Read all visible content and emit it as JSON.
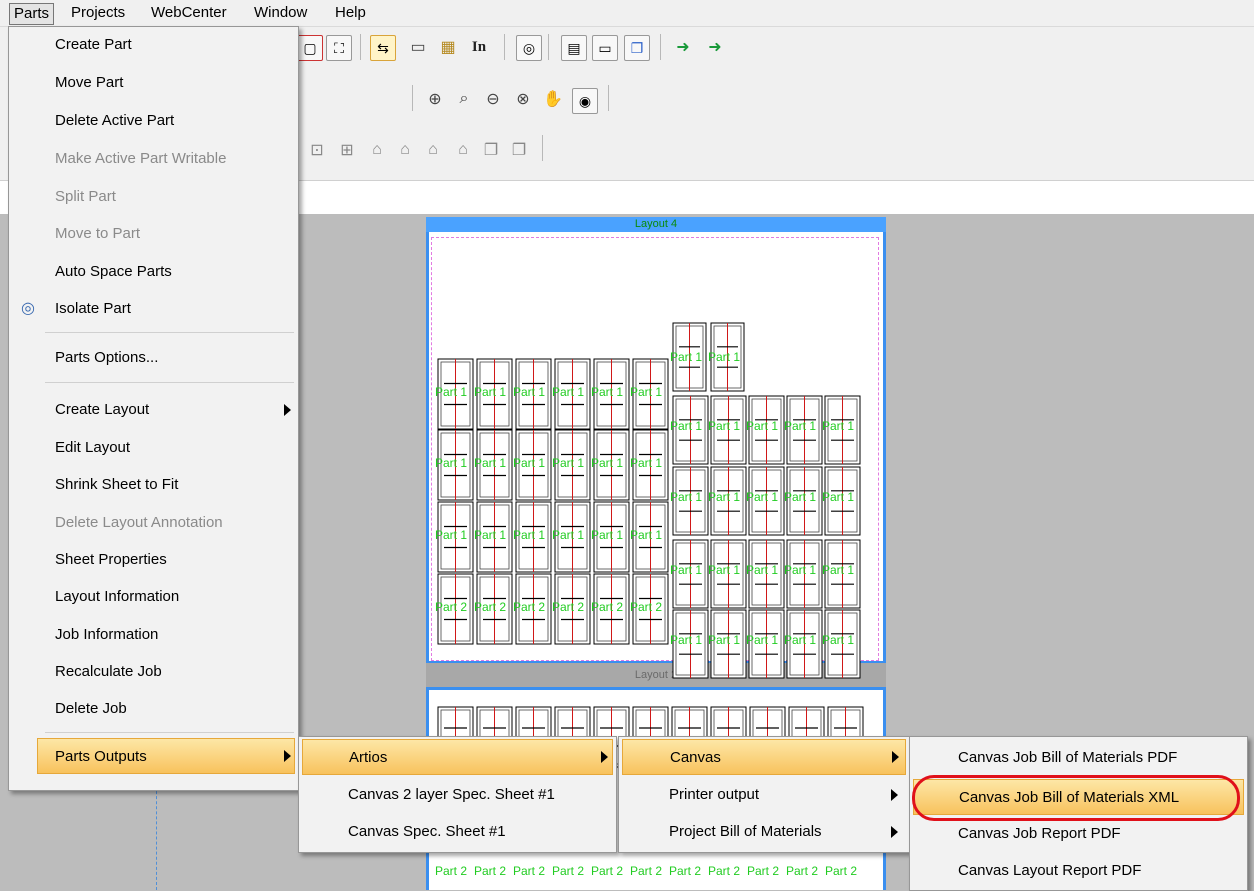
{
  "menubar": {
    "items": [
      "Parts",
      "Projects",
      "WebCenter",
      "Window",
      "Help"
    ]
  },
  "toolbar": {
    "in_label": "In"
  },
  "layouts": {
    "top_label": "Layout 4",
    "second_label": "Layout 2",
    "cell_label_1": "Part 1",
    "cell_label_2": "Part 2"
  },
  "parts_menu": {
    "items": [
      {
        "label": "Create Part",
        "enabled": true
      },
      {
        "label": "Move Part",
        "enabled": true
      },
      {
        "label": "Delete Active Part",
        "enabled": true
      },
      {
        "label": "Make Active Part Writable",
        "enabled": false
      },
      {
        "label": "Split Part",
        "enabled": false
      },
      {
        "label": "Move to Part",
        "enabled": false
      },
      {
        "label": "Auto Space Parts",
        "enabled": true
      },
      {
        "label": "Isolate Part",
        "enabled": true,
        "icon": "isolate-icon"
      },
      {
        "label": "Parts Options...",
        "enabled": true
      },
      {
        "label": "Create Layout",
        "enabled": true,
        "submenu": true
      },
      {
        "label": "Edit Layout",
        "enabled": true
      },
      {
        "label": "Shrink Sheet to Fit",
        "enabled": true
      },
      {
        "label": "Delete Layout Annotation",
        "enabled": false
      },
      {
        "label": "Sheet Properties",
        "enabled": true
      },
      {
        "label": "Layout Information",
        "enabled": true
      },
      {
        "label": "Job Information",
        "enabled": true
      },
      {
        "label": "Recalculate Job",
        "enabled": true
      },
      {
        "label": "Delete Job",
        "enabled": true
      },
      {
        "label": "Parts Outputs",
        "enabled": true,
        "submenu": true,
        "highlighted": true
      }
    ]
  },
  "outputs_menu": {
    "items": [
      {
        "label": "Artios",
        "submenu": true,
        "highlighted": true
      },
      {
        "label": "Canvas 2 layer Spec. Sheet #1"
      },
      {
        "label": "Canvas Spec. Sheet #1"
      }
    ]
  },
  "artios_menu": {
    "items": [
      {
        "label": "Canvas",
        "submenu": true,
        "highlighted": true
      },
      {
        "label": "Printer output",
        "submenu": true
      },
      {
        "label": "Project Bill of Materials",
        "submenu": true
      }
    ]
  },
  "canvas_menu": {
    "items": [
      {
        "label": "Canvas Job Bill of Materials PDF"
      },
      {
        "label": "Canvas Job Bill of Materials XML",
        "highlighted": true
      },
      {
        "label": "Canvas Job Report PDF"
      },
      {
        "label": "Canvas Layout Report PDF"
      }
    ]
  },
  "colors": {
    "highlight": "#f8c25d",
    "annotation": "#e0101a",
    "sheet_border": "#3a8ff0",
    "part_label": "#22cc22"
  }
}
